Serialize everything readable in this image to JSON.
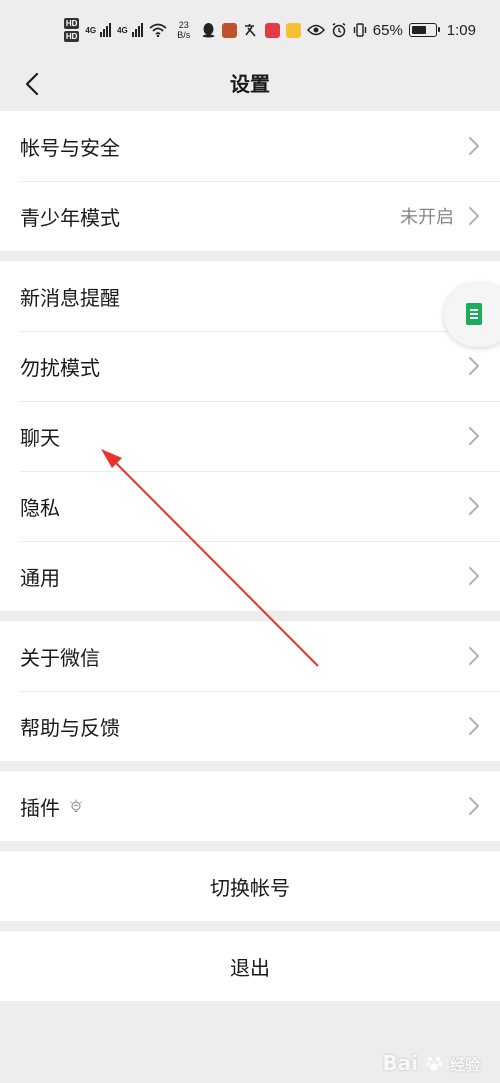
{
  "status_bar": {
    "net1": "4G",
    "net2": "4G",
    "speed_value": "23",
    "speed_unit": "B/s",
    "battery_percent": 65,
    "battery_text": "65%",
    "time": "1:09"
  },
  "nav": {
    "title": "设置"
  },
  "groups": [
    {
      "rows": [
        {
          "label": "帐号与安全",
          "value": ""
        },
        {
          "label": "青少年模式",
          "value": "未开启"
        }
      ]
    },
    {
      "rows": [
        {
          "label": "新消息提醒"
        },
        {
          "label": "勿扰模式"
        },
        {
          "label": "聊天"
        },
        {
          "label": "隐私"
        },
        {
          "label": "通用"
        }
      ]
    },
    {
      "rows": [
        {
          "label": "关于微信"
        },
        {
          "label": "帮助与反馈"
        }
      ]
    },
    {
      "rows": [
        {
          "label": "插件"
        }
      ]
    }
  ],
  "actions": {
    "switch_account": "切换帐号",
    "logout": "退出"
  },
  "watermark": {
    "brand": "Bai",
    "suffix": "经验"
  },
  "colors": {
    "background": "#ededed",
    "annotation_arrow": "#e8322b",
    "float_doc": "#1aad5a"
  }
}
